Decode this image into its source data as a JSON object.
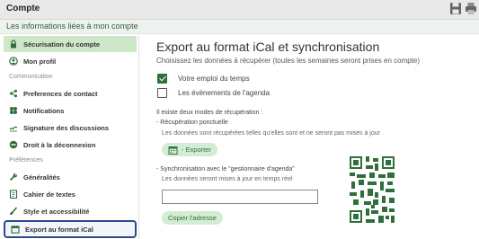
{
  "window": {
    "title": "Compte",
    "icons": [
      "save-icon",
      "print-icon"
    ]
  },
  "section_header": "Les informations liées à mon compte",
  "sidebar": {
    "items": [
      {
        "label": "Sécurisation du compte",
        "icon": "lock-icon"
      },
      {
        "label": "Mon profil",
        "icon": "profile-icon"
      },
      {
        "label": "Preferences de contact",
        "icon": "share-icon"
      },
      {
        "label": "Notifications",
        "icon": "notification-icon"
      },
      {
        "label": "Signature des discussions",
        "icon": "signature-icon"
      },
      {
        "label": "Droit à la déconnexion",
        "icon": "disconnect-icon"
      },
      {
        "label": "Généralités",
        "icon": "wrench-icon"
      },
      {
        "label": "Cahier de textes",
        "icon": "notebook-icon"
      },
      {
        "label": "Style et accessibilité",
        "icon": "brush-icon"
      },
      {
        "label": "Export au format iCal",
        "icon": "calendar-icon"
      }
    ],
    "groups": {
      "communication": "Communication",
      "preferences": "Préférences"
    },
    "active_index": 0,
    "highlighted_index": 9
  },
  "main": {
    "title": "Export au format iCal et synchronisation",
    "subtitle": "Choisissez les données à récupérer (toutes les semaines seront prises en compte)",
    "options": [
      {
        "label": "Votre emploi du temps",
        "checked": true
      },
      {
        "label": "Les évènements de l'agenda",
        "checked": false
      }
    ],
    "modes_intro": "Il existe deux modes de récupération :",
    "mode1_title": "- Récupération ponctuelle",
    "mode1_desc": "Les données sont récupérées telles qu'elles sont et ne seront pas mises à jour",
    "export_button": "- Exporter",
    "mode2_title": "- Synchronisation avec le \"gestionnaire d'agenda\"",
    "mode2_desc": "Les données seront mises à jour en temps réel",
    "sync_url_value": "",
    "copy_button": "Copier l'adresse"
  },
  "colors": {
    "accent_green": "#2f6f3a",
    "active_bg": "#cfe7c9",
    "highlight_border": "#2b4b8d"
  }
}
